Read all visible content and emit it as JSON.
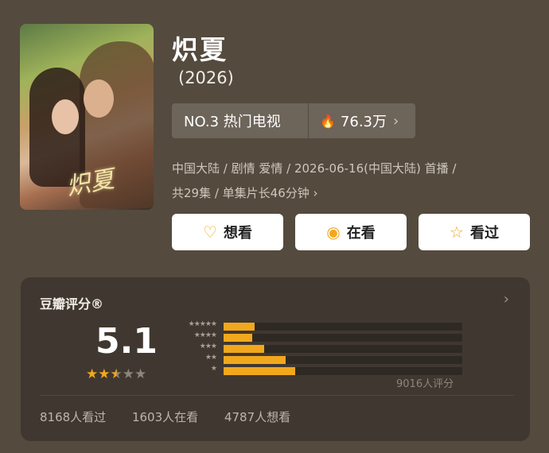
{
  "show": {
    "title": "炽夏",
    "year": "(2026)",
    "poster_title": "炽夏",
    "rank": "NO.3 热门电视",
    "heat": "76.3万",
    "meta_line1": "中国大陆 / 剧情 爱情 / 2026-06-16(中国大陆) 首播 /",
    "meta_line2": "共29集 / 单集片长46分钟 ›"
  },
  "buttons": {
    "want": "想看",
    "watching": "在看",
    "watched": "看过"
  },
  "rating": {
    "label": "豆瓣评分®",
    "score": "5.1",
    "stars": 2.5,
    "star_labels": [
      "★★★★★",
      "★★★★",
      "★★★",
      "★★",
      "★"
    ],
    "distribution_fraction": [
      0.13,
      0.12,
      0.17,
      0.26,
      0.3
    ],
    "votes": "9016人评分",
    "watched": "8168人看过",
    "watching": "1603人在看",
    "want": "4787人想看"
  },
  "colors": {
    "background": "#544a3e",
    "accent": "#f2a81d",
    "card": "#403830"
  }
}
